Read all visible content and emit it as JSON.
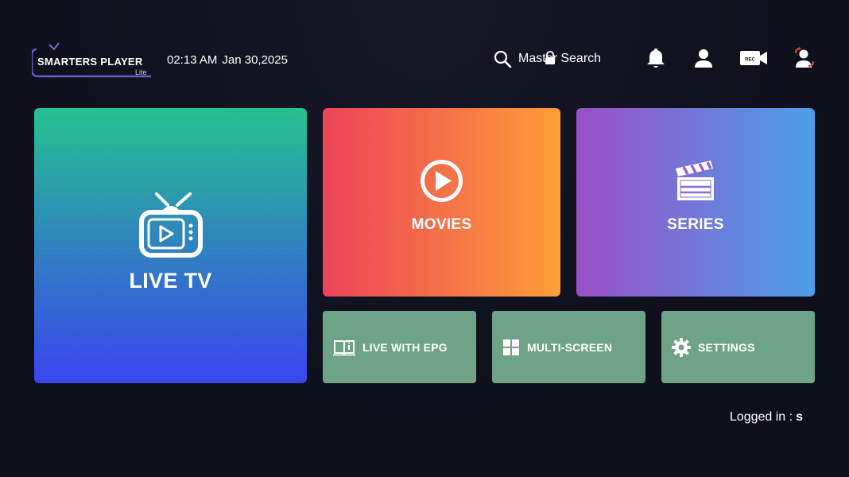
{
  "header": {
    "logo_title": "SMARTERS PLAYER",
    "logo_subtitle": "Lite",
    "time": "02:13 AM",
    "date": "Jan 30,2025",
    "search_label": "Master Search",
    "icons": [
      "search-icon",
      "lock-icon",
      "bell-icon",
      "user-icon",
      "rec-camera-icon",
      "switch-user-icon"
    ],
    "rec_text": "REC"
  },
  "tiles": {
    "live_tv": "LIVE TV",
    "movies": "MOVIES",
    "series": "SERIES",
    "live_with_epg": "LIVE WITH EPG",
    "multi_screen": "MULTI-SCREEN",
    "settings": "SETTINGS"
  },
  "footer": {
    "logged_in_label": "Logged in :",
    "username": "s"
  },
  "colors": {
    "background": "#10111e",
    "live_tv_gradient": [
      "#25c28f",
      "#3a44ef"
    ],
    "movies_gradient": [
      "#ec4359",
      "#fd9f38"
    ],
    "series_gradient": [
      "#9b4fc7",
      "#4ba0e8"
    ],
    "small_tile": "#6fa387",
    "logo_accent": "#6a5acd"
  }
}
